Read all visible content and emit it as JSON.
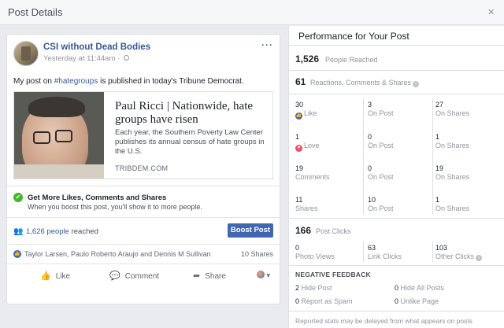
{
  "modal": {
    "title": "Post Details",
    "close_glyph": "×"
  },
  "post": {
    "page_name": "CSI without Dead Bodies",
    "timestamp": "Yesterday at 11:44am",
    "text_prefix": "My post on ",
    "hashtag": "#hategroups",
    "text_suffix": " is published in today's Tribune Democrat.",
    "link": {
      "title": "Paul Ricci | Nationwide, hate groups have risen",
      "description": "Each year, the Southern Poverty Law Center publishes its annual census of hate groups in the U.S.",
      "domain": "TRIBDEM.COM"
    },
    "boost": {
      "title": "Get More Likes, Comments and Shares",
      "subtitle": "When you boost this post, you'll show it to more people.",
      "people_reached_link": "1,626 people",
      "reached_suffix": " reached",
      "button_label": "Boost Post"
    },
    "reactors": "Taylor Larsen, Paulo Roberto Araujo and Dennis M Sullivan",
    "shares": "10 Shares",
    "actions": {
      "like": "Like",
      "comment": "Comment",
      "share": "Share"
    }
  },
  "performance": {
    "title": "Performance for Your Post",
    "people_reached": {
      "value": "1,526",
      "label": "People Reached"
    },
    "engagement": {
      "value": "61",
      "label": "Reactions, Comments & Shares"
    },
    "rows": [
      {
        "label": "Like",
        "total": "30",
        "on_post": "3",
        "on_shares": "27"
      },
      {
        "label": "Love",
        "total": "1",
        "on_post": "0",
        "on_shares": "1"
      },
      {
        "label": "Comments",
        "total": "19",
        "on_post": "0",
        "on_shares": "19"
      },
      {
        "label": "Shares",
        "total": "11",
        "on_post": "10",
        "on_shares": "1"
      }
    ],
    "on_post_label": "On Post",
    "on_shares_label": "On Shares",
    "post_clicks": {
      "value": "166",
      "label": "Post Clicks"
    },
    "clicks": [
      {
        "value": "0",
        "label": "Photo Views"
      },
      {
        "value": "63",
        "label": "Link Clicks"
      },
      {
        "value": "103",
        "label": "Other Clicks"
      }
    ],
    "negative_feedback": {
      "title": "NEGATIVE FEEDBACK",
      "items": [
        {
          "value": "2",
          "label": "Hide Post"
        },
        {
          "value": "0",
          "label": "Hide All Posts"
        },
        {
          "value": "0",
          "label": "Report as Spam"
        },
        {
          "value": "0",
          "label": "Unlike Page"
        }
      ]
    },
    "footnote": "Reported stats may be delayed from what appears on posts"
  }
}
